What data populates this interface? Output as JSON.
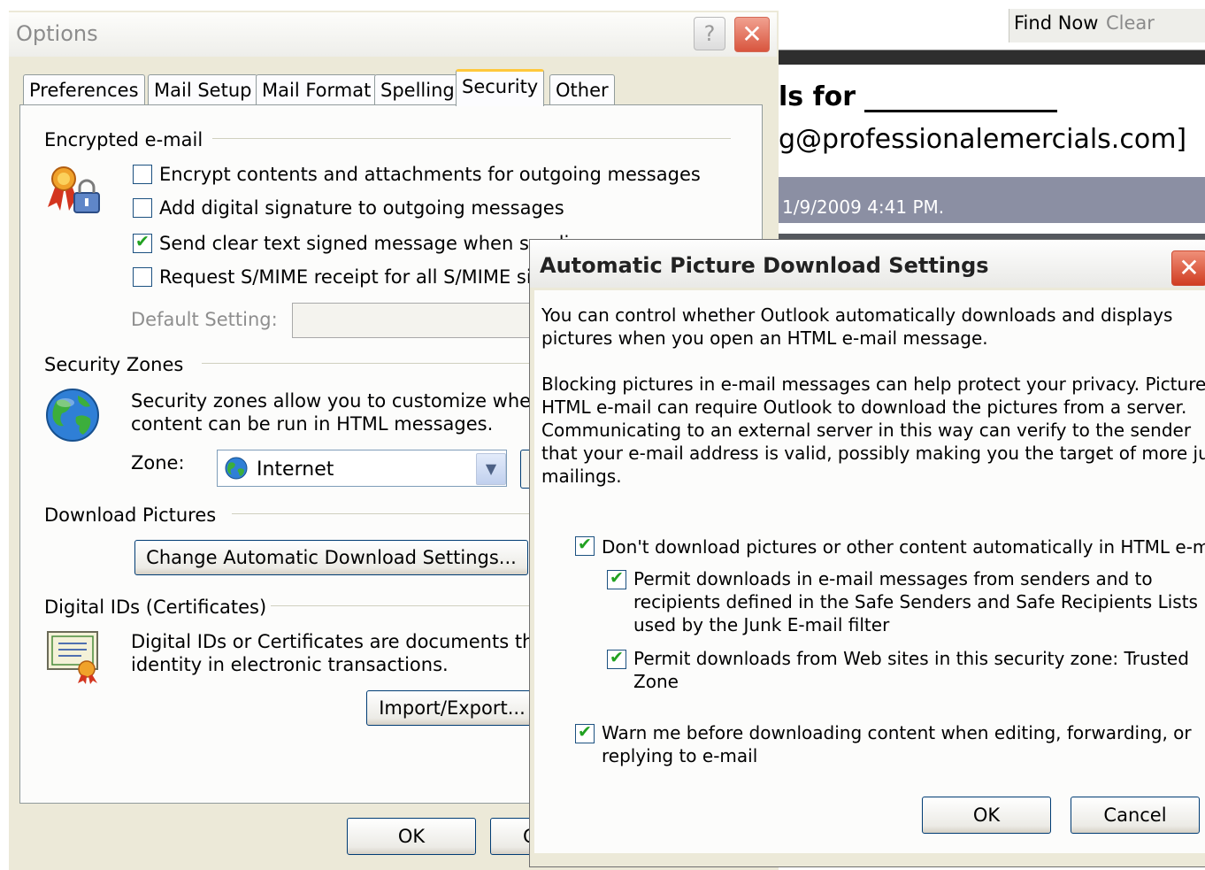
{
  "background_email": {
    "find_now": "Find Now",
    "clear": "Clear",
    "subject_fragment": "ls for",
    "from_fragment": "g@professionalemercials.com]",
    "date_fragment": "1/9/2009 4:41 PM."
  },
  "options_dialog": {
    "title": "Options",
    "help_button": "?",
    "close_button": "✕",
    "tabs": [
      {
        "label": "Preferences"
      },
      {
        "label": "Mail Setup"
      },
      {
        "label": "Mail Format"
      },
      {
        "label": "Spelling"
      },
      {
        "label": "Security",
        "active": true
      },
      {
        "label": "Other"
      }
    ],
    "encrypted": {
      "heading": "Encrypted e-mail",
      "options": [
        {
          "label": "Encrypt contents and attachments for outgoing messages",
          "checked": false
        },
        {
          "label": "Add digital signature to outgoing messages",
          "checked": false
        },
        {
          "label": "Send clear text signed message when sendi",
          "checked": true
        },
        {
          "label": "Request S/MIME receipt for all S/MIME sign",
          "checked": false
        }
      ],
      "default_setting_label": "Default Setting:"
    },
    "zones": {
      "heading": "Security Zones",
      "description_line1": "Security zones allow you to customize whether",
      "description_line2": "content can be run in HTML messages.",
      "zone_label": "Zone:",
      "zone_value": "Internet"
    },
    "download": {
      "heading": "Download Pictures",
      "button": "Change Automatic Download Settings..."
    },
    "digital_ids": {
      "heading": "Digital IDs (Certificates)",
      "description_line1": "Digital IDs or Certificates are documents that a",
      "description_line2": "identity in electronic transactions.",
      "import_button": "Import/Export..."
    },
    "ok_button": "OK",
    "cancel_stub": "C"
  },
  "picture_dialog": {
    "title": "Automatic Picture Download Settings",
    "close_button": "✕",
    "intro_line1": "You can control whether Outlook automatically downloads and displays",
    "intro_line2": "pictures when you open an HTML e-mail message.",
    "privacy_lines": [
      "Blocking pictures in e-mail messages can help protect your privacy. Pictures in",
      "HTML e-mail can require Outlook to download the pictures from a server.",
      "Communicating to an external server in this way can verify to the sender",
      "that your e-mail address is valid, possibly making you the target of more junk",
      "mailings."
    ],
    "options": [
      {
        "lines": [
          "Don't download pictures or other content automatically in HTML e-mail"
        ],
        "checked": true
      },
      {
        "lines": [
          "Permit downloads in e-mail messages from senders and to",
          "recipients defined in the Safe Senders and Safe Recipients Lists",
          "used by the Junk E-mail filter"
        ],
        "checked": true
      },
      {
        "lines": [
          "Permit downloads from Web sites in this security zone: Trusted",
          "Zone"
        ],
        "checked": true
      },
      {
        "lines": [
          "Warn me before downloading content when editing, forwarding, or",
          "replying to e-mail"
        ],
        "checked": true
      }
    ],
    "ok_button": "OK",
    "cancel_button": "Cancel"
  },
  "colors": {
    "dialog_bg": "#ece9d8",
    "panel_bg": "#fcfcfb",
    "active_tab_accent": "#ffc83c",
    "check_color": "#21a121",
    "close_red": "#d8553e",
    "date_bar": "#8b8fa3"
  }
}
